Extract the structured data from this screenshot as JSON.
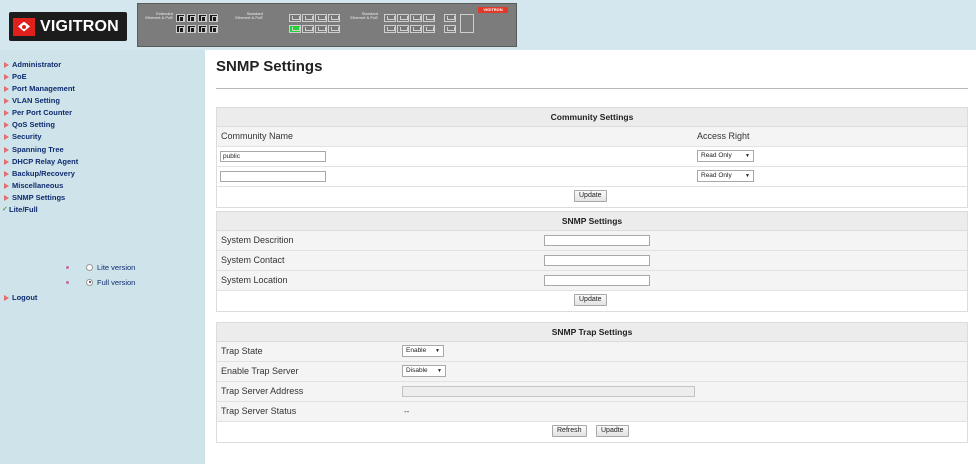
{
  "header": {
    "logo_text": "VIGITRON",
    "panel": {
      "label_left": "Extended Ethernet & PoE",
      "label_mid": "Standard Ethernet & PoE",
      "label_right": "Standard Ethernet & PoE",
      "mini_logo": "VIGITRON"
    }
  },
  "sidebar": {
    "items": [
      {
        "label": "Administrator"
      },
      {
        "label": "PoE"
      },
      {
        "label": "Port Management"
      },
      {
        "label": "VLAN Setting"
      },
      {
        "label": "Per Port Counter"
      },
      {
        "label": "QoS Setting"
      },
      {
        "label": "Security"
      },
      {
        "label": "Spanning Tree"
      },
      {
        "label": "DHCP Relay Agent"
      },
      {
        "label": "Backup/Recovery"
      },
      {
        "label": "Miscellaneous"
      },
      {
        "label": "SNMP Settings"
      }
    ],
    "lite_full": "Lite/Full",
    "versions": [
      {
        "label": "Lite version",
        "checked": false
      },
      {
        "label": "Full version",
        "checked": true
      }
    ],
    "logout": "Logout"
  },
  "main": {
    "page_title": "SNMP Settings",
    "community": {
      "heading": "Community Settings",
      "col_name": "Community Name",
      "col_access": "Access Right",
      "rows": [
        {
          "name": "public",
          "access": "Read Only"
        },
        {
          "name": "",
          "access": "Read Only"
        }
      ],
      "update_label": "Update"
    },
    "snmp": {
      "heading": "SNMP Settings",
      "fields": [
        {
          "label": "System Descrition",
          "value": ""
        },
        {
          "label": "System Contact",
          "value": ""
        },
        {
          "label": "System Location",
          "value": ""
        }
      ],
      "update_label": "Update"
    },
    "trap": {
      "heading": "SNMP Trap Settings",
      "state_label": "Trap State",
      "state_value": "Enable",
      "server_label": "Enable Trap Server",
      "server_value": "Disable",
      "address_label": "Trap Server Address",
      "address_value": "",
      "status_label": "Trap Server Status",
      "status_value": "--",
      "refresh_label": "Refresh",
      "update_label": "Upadte"
    }
  },
  "colors": {
    "header_bg": "#d4e6ee",
    "sidebar_bg": "#cfe3ea",
    "nav_text": "#0f2c70",
    "logo_red": "#e0201c"
  }
}
